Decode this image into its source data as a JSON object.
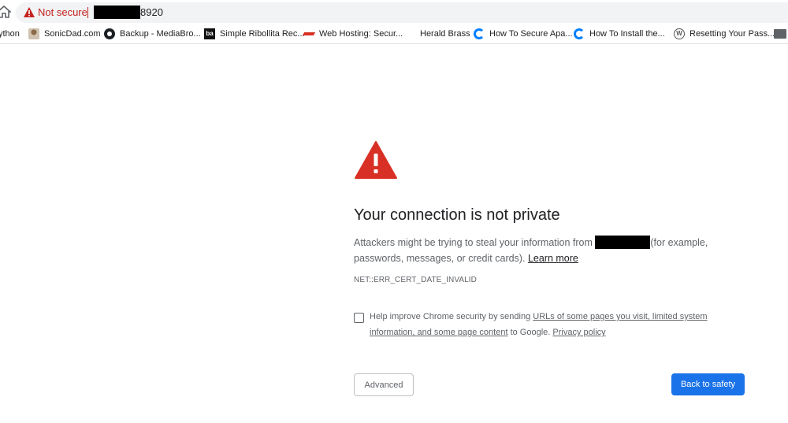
{
  "browser": {
    "omnibox": {
      "security_label": "Not secure",
      "url_suffix": "8920"
    },
    "bookmarks": [
      {
        "label": "ython",
        "icon": "none"
      },
      {
        "label": "SonicDad.com",
        "icon": "sonicdad-icon"
      },
      {
        "label": "Backup - MediaBro...",
        "icon": "github-icon"
      },
      {
        "label": "Simple Ribollita Rec...",
        "icon": "ba-icon"
      },
      {
        "label": "Web Hosting: Secur...",
        "icon": "webhosting-icon"
      },
      {
        "label": "Herald Brass",
        "icon": "none"
      },
      {
        "label": "How To Secure Apa...",
        "icon": "digitalocean-icon"
      },
      {
        "label": "How To Install the...",
        "icon": "digitalocean-icon"
      },
      {
        "label": "Resetting Your Pass...",
        "icon": "wordpress-icon"
      }
    ]
  },
  "interstitial": {
    "title": "Your connection is not private",
    "body_prefix": "Attackers might be trying to steal your information from",
    "body_suffix": "(for example, passwords, messages, or credit cards).",
    "learn_more": "Learn more",
    "error_code": "NET::ERR_CERT_DATE_INVALID",
    "checkbox": {
      "checked": false,
      "prefix": "Help improve Chrome security by sending",
      "link_text": "URLs of some pages you visit, limited system information, and some page content",
      "middle": "to Google.",
      "privacy_link": "Privacy policy"
    },
    "advanced_button": "Advanced",
    "back_button": "Back to safety"
  },
  "colors": {
    "warning_red": "#d93025",
    "not_secure_red": "#c5221f",
    "primary_blue": "#1a73e8",
    "text_dark": "#202124",
    "text_gray": "#5f6368"
  }
}
